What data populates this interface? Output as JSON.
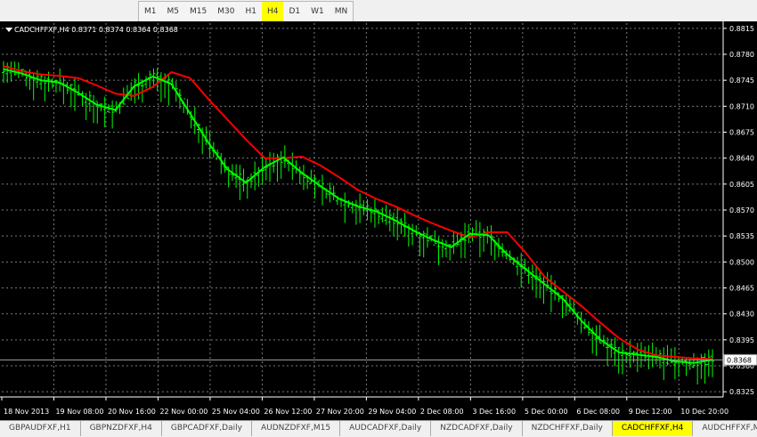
{
  "toolbar": {
    "timeframes": [
      {
        "label": "M1",
        "active": false
      },
      {
        "label": "M5",
        "active": false
      },
      {
        "label": "M15",
        "active": false
      },
      {
        "label": "M30",
        "active": false
      },
      {
        "label": "H1",
        "active": false
      },
      {
        "label": "H4",
        "active": true
      },
      {
        "label": "D1",
        "active": false
      },
      {
        "label": "W1",
        "active": false
      },
      {
        "label": "MN",
        "active": false
      }
    ]
  },
  "chart": {
    "header": "CADCHFFXF,H4  0.8371 0.8374 0.8364 0.8368",
    "current_price_label": "0.8368",
    "colors": {
      "background": "#000000",
      "grid": "#7a7a7a",
      "bars": "#00ff00",
      "slow_ma": "#ff0000",
      "fast_ma": "#00ff00",
      "axis": "#ffffff"
    }
  },
  "chart_data": {
    "type": "line",
    "y_ticks": [
      "0.8815",
      "0.8780",
      "0.8745",
      "0.8710",
      "0.8675",
      "0.8640",
      "0.8605",
      "0.8570",
      "0.8535",
      "0.8500",
      "0.8465",
      "0.8430",
      "0.8395",
      "0.8360",
      "0.8325"
    ],
    "ylim": [
      0.8318,
      0.8822
    ],
    "x_ticks": [
      "18 Nov 2013",
      "19 Nov 08:00",
      "20 Nov 16:00",
      "22 Nov 00:00",
      "25 Nov 04:00",
      "26 Nov 12:00",
      "27 Nov 20:00",
      "29 Nov 04:00",
      "2 Dec 08:00",
      "3 Dec 16:00",
      "5 Dec 00:00",
      "6 Dec 08:00",
      "9 Dec 12:00",
      "10 Dec 20:00"
    ],
    "current_price": 0.8368,
    "series": [
      {
        "values": [
          0.8764,
          0.8757,
          0.8753,
          0.8751,
          0.8748,
          0.8738,
          0.8727,
          0.8724,
          0.8736,
          0.8756,
          0.8748,
          0.8719,
          0.8692,
          0.8665,
          0.864,
          0.864,
          0.8642,
          0.863,
          0.8614,
          0.8597,
          0.8585,
          0.8575,
          0.8563,
          0.8552,
          0.8542,
          0.8533,
          0.854,
          0.854,
          0.8512,
          0.848,
          0.846,
          0.844,
          0.8418,
          0.8397,
          0.8382,
          0.8374,
          0.8372,
          0.837,
          0.8369
        ]
      },
      {
        "values": [
          0.876,
          0.8754,
          0.8745,
          0.8742,
          0.8728,
          0.8712,
          0.8705,
          0.8737,
          0.875,
          0.874,
          0.87,
          0.866,
          0.8625,
          0.8607,
          0.8628,
          0.8641,
          0.862,
          0.8602,
          0.8585,
          0.8575,
          0.8568,
          0.8556,
          0.8542,
          0.853,
          0.852,
          0.8538,
          0.8536,
          0.851,
          0.849,
          0.847,
          0.845,
          0.842,
          0.8395,
          0.8378,
          0.8375,
          0.8372,
          0.8366,
          0.8364,
          0.8368
        ]
      }
    ]
  },
  "tabs": [
    {
      "label": "GBPAUDFXF,H1",
      "active": false
    },
    {
      "label": "GBPNZDFXF,H4",
      "active": false
    },
    {
      "label": "GBPCADFXF,Daily",
      "active": false
    },
    {
      "label": "AUDNZDFXF,M15",
      "active": false
    },
    {
      "label": "AUDCADFXF,Daily",
      "active": false
    },
    {
      "label": "NZDCADFXF,Daily",
      "active": false
    },
    {
      "label": "NZDCHFFXF,Daily",
      "active": false
    },
    {
      "label": "CADCHFFXF,H4",
      "active": true
    },
    {
      "label": "AUDCHFFXF,Mo",
      "active": false
    }
  ]
}
